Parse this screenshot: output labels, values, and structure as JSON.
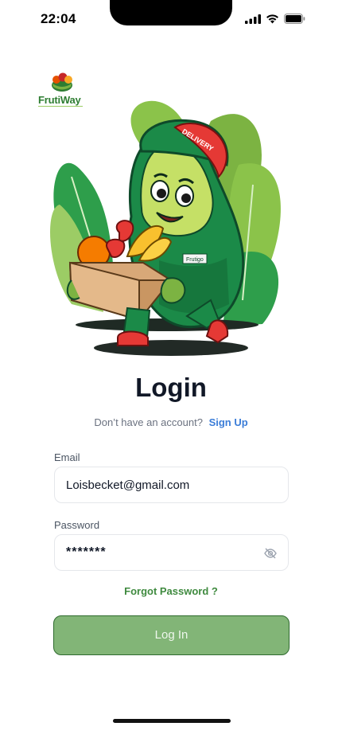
{
  "status": {
    "time": "22:04",
    "icons": [
      "signal-icon",
      "wifi-icon",
      "battery-icon"
    ]
  },
  "brand": {
    "name": "FrutiWay",
    "primary_color": "#2e7d32",
    "button_color": "#82b577"
  },
  "hero": {
    "cap_text": "DELIVERY",
    "badge_text": "Frutigo"
  },
  "login": {
    "title": "Login",
    "no_account_text": "Don’t have an account?",
    "signup_label": "Sign Up",
    "email_label": "Email",
    "email_value": "Loisbecket@gmail.com",
    "password_label": "Password",
    "password_value": "*******",
    "forgot_label": "Forgot Password ?",
    "submit_label": "Log In"
  }
}
